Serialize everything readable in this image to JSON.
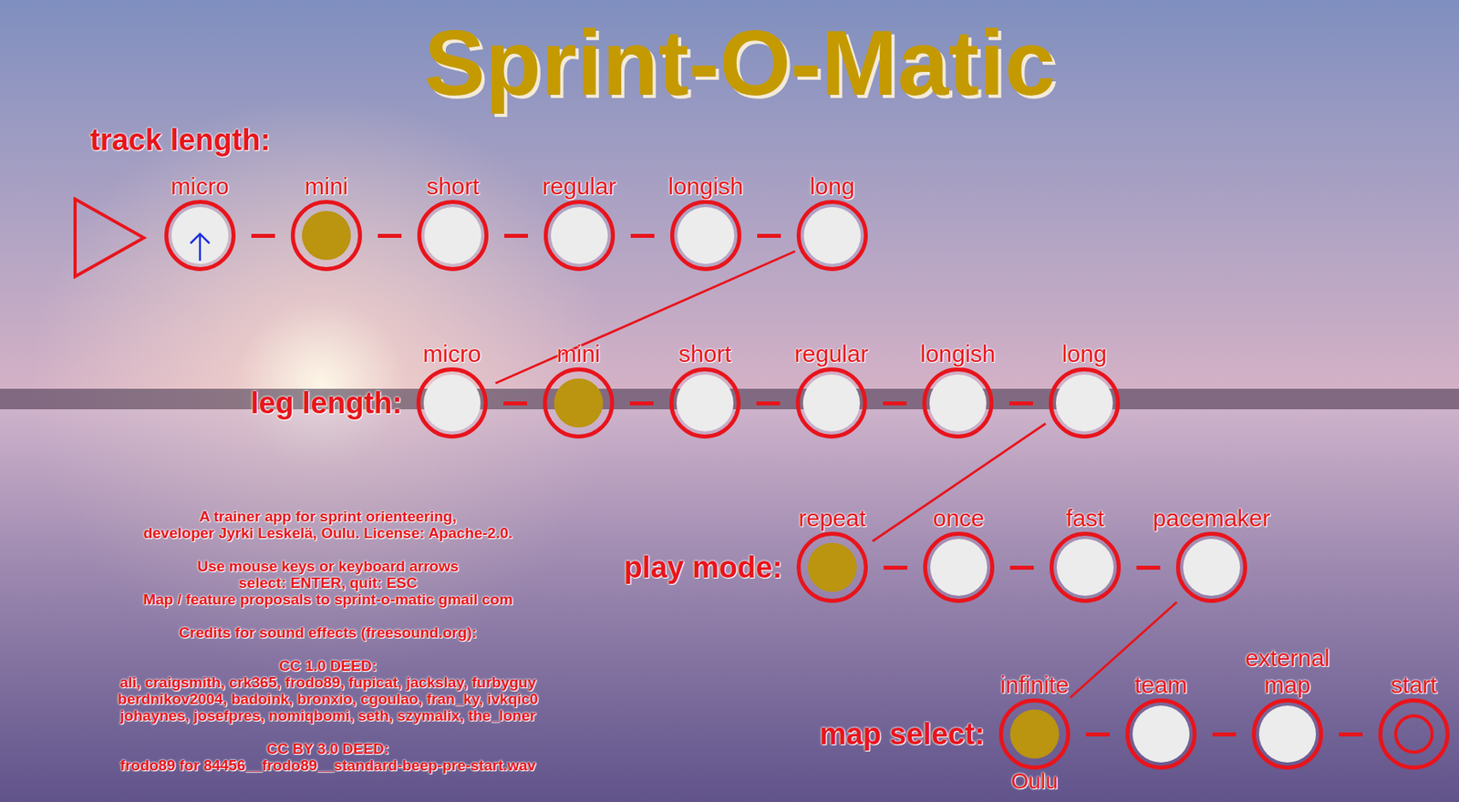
{
  "title": "Sprint-O-Matic",
  "sections": [
    {
      "label": "track length:",
      "options": [
        {
          "label": "micro",
          "kind": "radio",
          "selected": false,
          "focused": true
        },
        {
          "label": "mini",
          "kind": "radio",
          "selected": true,
          "focused": false
        },
        {
          "label": "short",
          "kind": "radio",
          "selected": false,
          "focused": false
        },
        {
          "label": "regular",
          "kind": "radio",
          "selected": false,
          "focused": false
        },
        {
          "label": "longish",
          "kind": "radio",
          "selected": false,
          "focused": false
        },
        {
          "label": "long",
          "kind": "radio",
          "selected": false,
          "focused": false
        }
      ]
    },
    {
      "label": "leg length:",
      "options": [
        {
          "label": "micro",
          "kind": "radio",
          "selected": false,
          "focused": false
        },
        {
          "label": "mini",
          "kind": "radio",
          "selected": true,
          "focused": false
        },
        {
          "label": "short",
          "kind": "radio",
          "selected": false,
          "focused": false
        },
        {
          "label": "regular",
          "kind": "radio",
          "selected": false,
          "focused": false
        },
        {
          "label": "longish",
          "kind": "radio",
          "selected": false,
          "focused": false
        },
        {
          "label": "long",
          "kind": "radio",
          "selected": false,
          "focused": false
        }
      ]
    },
    {
      "label": "play mode:",
      "options": [
        {
          "label": "repeat",
          "kind": "radio",
          "selected": true,
          "focused": false
        },
        {
          "label": "once",
          "kind": "radio",
          "selected": false,
          "focused": false
        },
        {
          "label": "fast",
          "kind": "radio",
          "selected": false,
          "focused": false
        },
        {
          "label": "pacemaker",
          "kind": "radio",
          "selected": false,
          "focused": false
        }
      ]
    },
    {
      "label": "map select:",
      "options": [
        {
          "label": "infinite",
          "kind": "radio",
          "selected": true,
          "focused": false,
          "note_below": "Oulu"
        },
        {
          "label": "team",
          "kind": "radio",
          "selected": false,
          "focused": false
        },
        {
          "label": "map",
          "kind": "radio",
          "selected": false,
          "focused": false,
          "note_above": "external"
        },
        {
          "label": "start",
          "kind": "start",
          "selected": false,
          "focused": false
        }
      ]
    }
  ],
  "info": [
    [
      "A trainer app for sprint orienteering,",
      "developer Jyrki Leskelä, Oulu. License: Apache-2.0."
    ],
    [
      "Use mouse keys or keyboard arrows",
      "select: ENTER, quit: ESC",
      "Map / feature proposals to sprint-o-matic gmail com"
    ],
    [
      "Credits for sound effects (freesound.org):"
    ],
    [
      "CC 1.0 DEED:",
      "ali, craigsmith, crk365, frodo89, fupicat, jackslay, furbyguy",
      "berdnikov2004, badoink, bronxio, cgoulao, fran_ky, ivkqic0",
      "johaynes, josefpres, nomiqbomi, seth, szymalix, the_loner"
    ],
    [
      "CC BY 3.0 DEED:",
      "frodo89 for 84456__frodo89__standard-beep-pre-start.wav"
    ]
  ]
}
